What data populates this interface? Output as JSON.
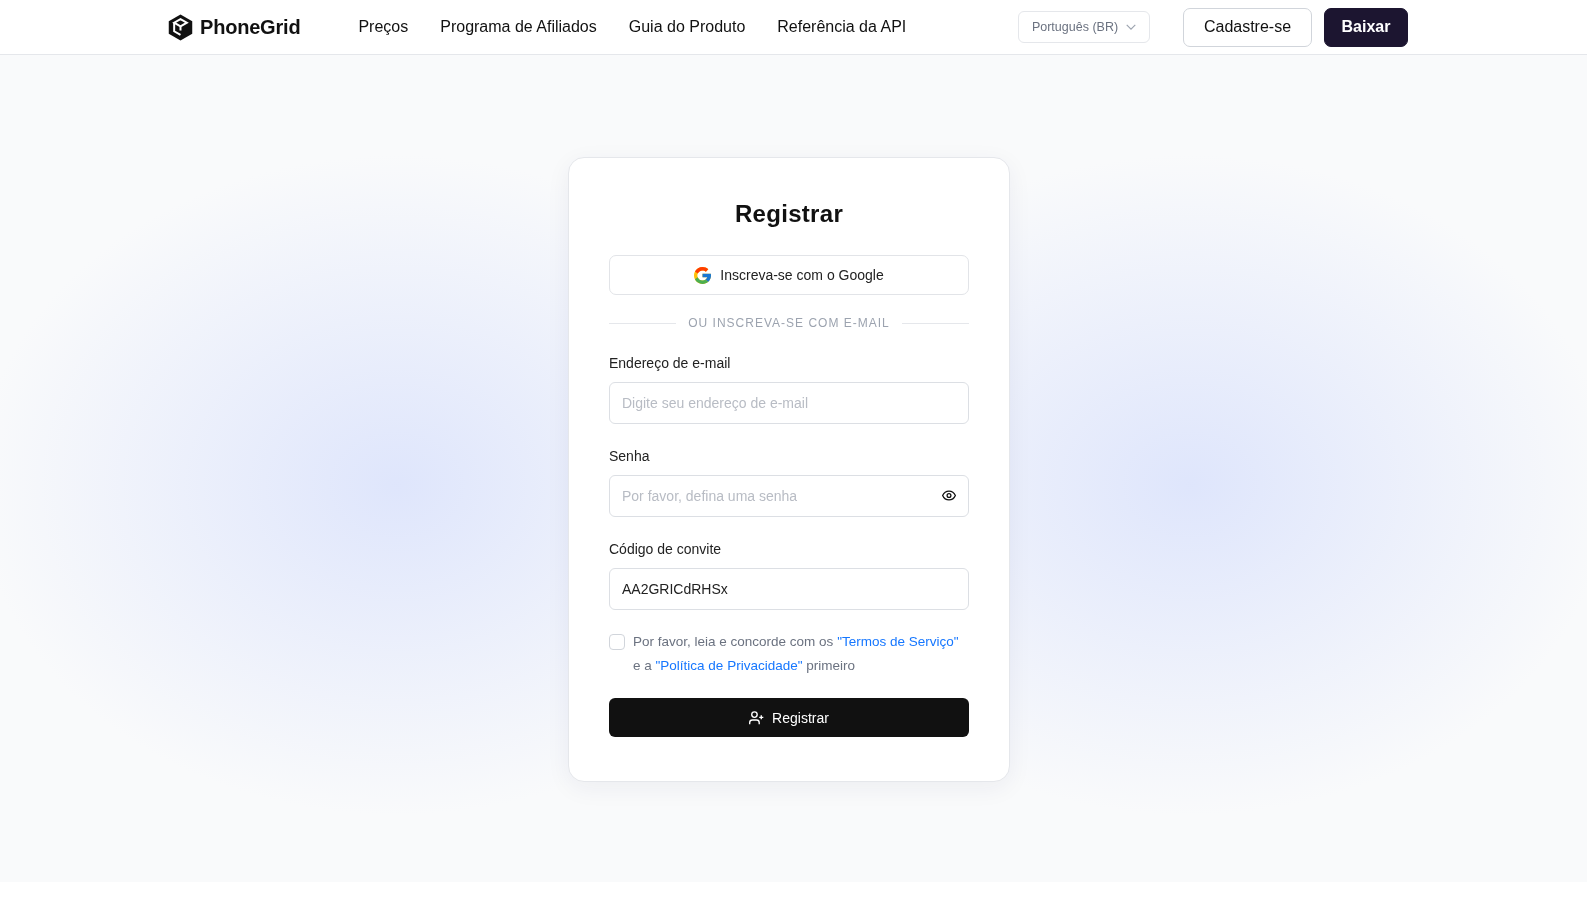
{
  "header": {
    "logo": {
      "name": "PhoneGrid"
    },
    "nav": [
      {
        "label": "Preços"
      },
      {
        "label": "Programa de Afiliados"
      },
      {
        "label": "Guia do Produto"
      },
      {
        "label": "Referência da API"
      }
    ],
    "language": {
      "value": "Português (BR)"
    },
    "buttons": [
      {
        "label": "Cadastre-se",
        "kind": "outline"
      },
      {
        "label": "Baixar",
        "kind": "primary"
      }
    ]
  },
  "form": {
    "title": "Registrar",
    "google_button": "Inscreva-se com o Google",
    "divider": "OU INSCREVA-SE COM E-MAIL",
    "fields": [
      {
        "label": "Endereço de e-mail",
        "placeholder": "Digite seu endereço de e-mail",
        "kind": "email"
      },
      {
        "label": "Senha",
        "placeholder": "Por favor, defina uma senha",
        "kind": "password"
      },
      {
        "label": "Código de convite",
        "value": "AA2GRICdRHSx",
        "kind": "code"
      }
    ],
    "agreement": {
      "checked": false,
      "parts": [
        {
          "text": "Por favor, leia e concorde com os",
          "kind": "text"
        },
        {
          "text": "\"Termos de Serviço\"",
          "kind": "link"
        },
        {
          "text": "e a",
          "kind": "text"
        },
        {
          "text": "\"Política de Privacidade\"",
          "kind": "link"
        },
        {
          "text": "primeiro",
          "kind": "text"
        }
      ]
    },
    "submit": "Registrar"
  }
}
